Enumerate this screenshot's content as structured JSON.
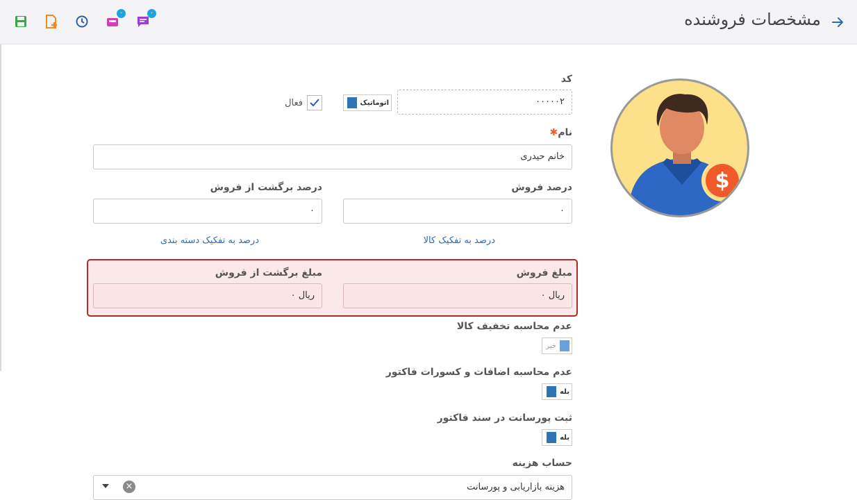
{
  "header": {
    "title": "مشخصات فروشنده",
    "icons": [
      "back-arrow-icon",
      "save-icon",
      "add-file-icon",
      "history-icon",
      "inbox-icon",
      "chat-icon"
    ],
    "badges": {
      "inbox": "۰",
      "chat": "۰"
    }
  },
  "form": {
    "code_label": "کد",
    "code_value": "۰۰۰۰۰۲",
    "auto_label": "اتوماتیک",
    "active_label": "فعال",
    "name_label": "نام",
    "name_value": "خانم حیدری",
    "sale_percent_label": "درصد فروش",
    "sale_percent_value": "۰",
    "return_percent_label": "درصد برگشت از فروش",
    "return_percent_value": "۰",
    "by_product_link": "درصد به تفکیک کالا",
    "by_category_link": "درصد به تفکیک دسته بندی",
    "sale_amount_label": "مبلغ فروش",
    "sale_amount_value": "ریال ۰",
    "return_amount_label": "مبلغ برگشت از فروش",
    "return_amount_value": "ریال ۰",
    "no_discount_label": "عدم محاسبه تخفیف کالا",
    "no_discount_value": "خیر",
    "no_additions_label": "عدم محاسبه اضافات و کسورات فاکتور",
    "no_additions_value": "بله",
    "commission_label": "ثبت پورسانت در سند فاکتور",
    "commission_value": "بله",
    "expense_account_label": "حساب هزینه",
    "expense_account_value": "هزینه بازاریابی و پورسانت"
  },
  "colors": {
    "accent": "#2e75b6",
    "highlight_border": "#b02a2a",
    "required": "#e8632b",
    "link": "#2a6bb0"
  }
}
